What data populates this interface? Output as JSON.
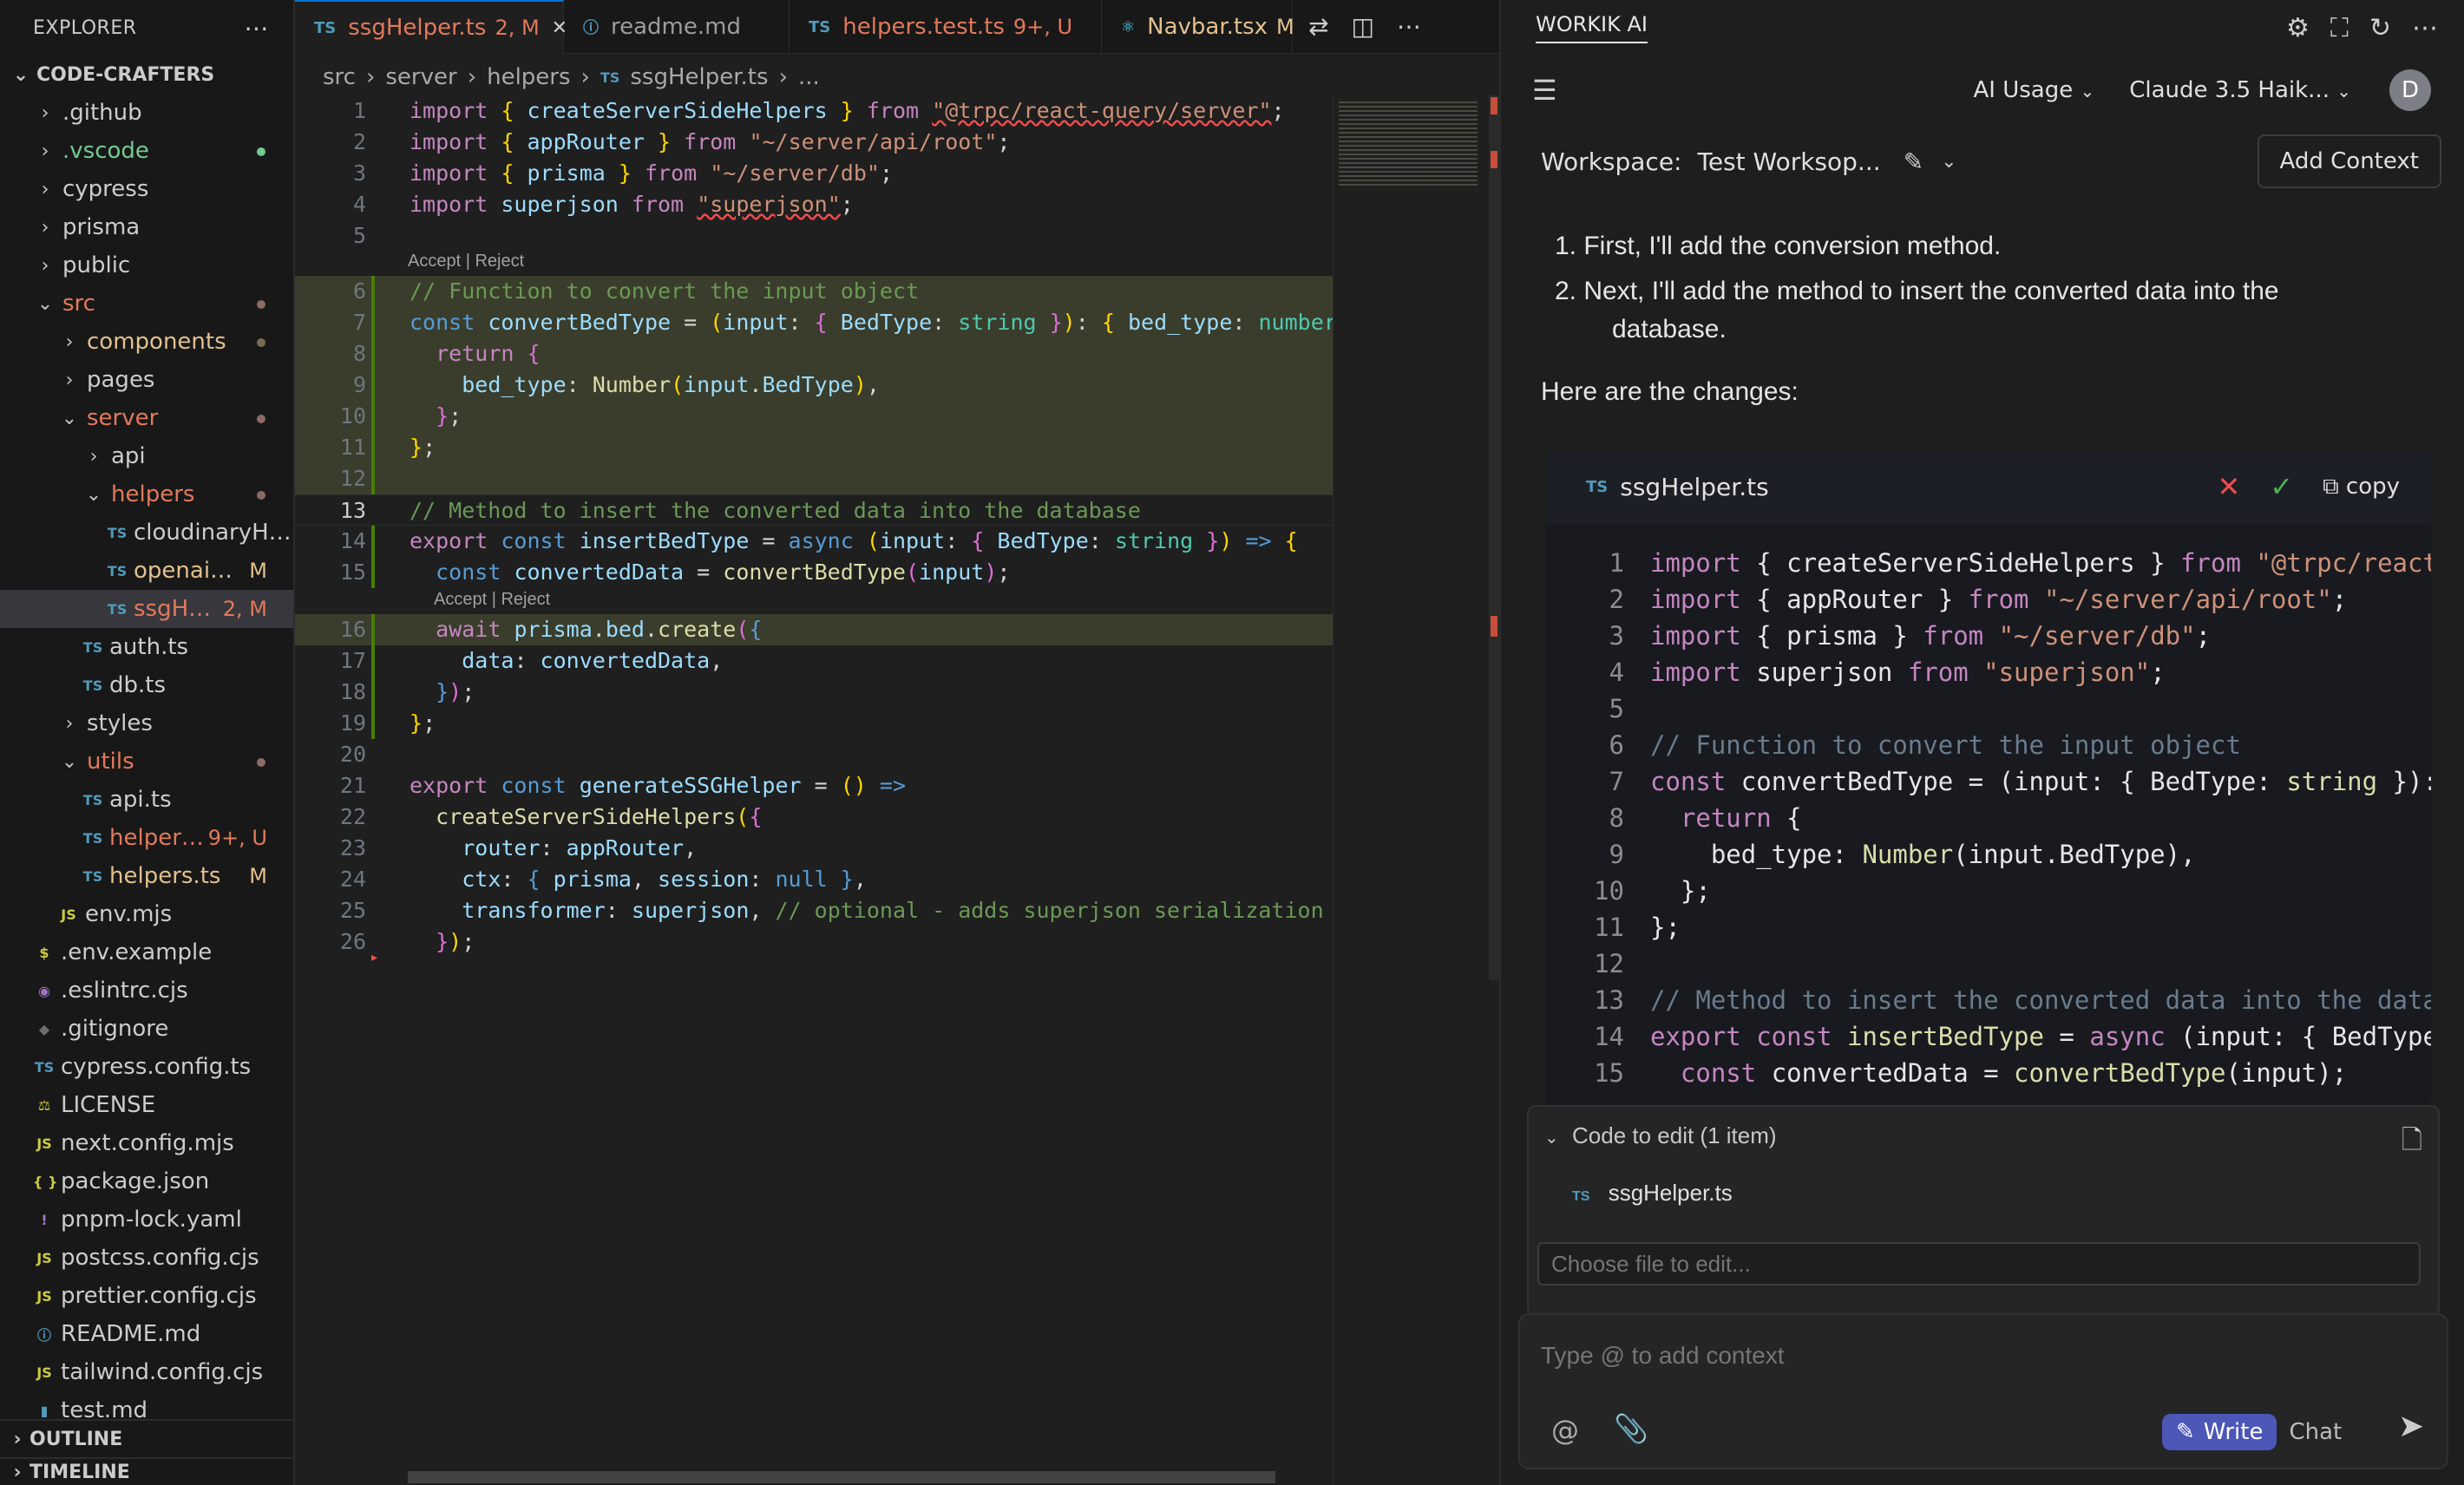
{
  "explorer": {
    "title": "EXPLORER",
    "more_icon": "ellipsis-icon",
    "root": "CODE-CRAFTERS",
    "items": [
      {
        "label": ".github",
        "type": "folder",
        "open": false,
        "depth": 1
      },
      {
        "label": ".vscode",
        "type": "folder",
        "open": false,
        "depth": 1,
        "color": "#73c991",
        "dot": "green"
      },
      {
        "label": "cypress",
        "type": "folder",
        "open": false,
        "depth": 1
      },
      {
        "label": "prisma",
        "type": "folder",
        "open": false,
        "depth": 1
      },
      {
        "label": "public",
        "type": "folder",
        "open": false,
        "depth": 1
      },
      {
        "label": "src",
        "type": "folder",
        "open": true,
        "depth": 1,
        "color": "#e2795b",
        "dot": "red"
      },
      {
        "label": "components",
        "type": "folder",
        "open": false,
        "depth": 2,
        "color": "#e2c08d",
        "dot": "brown"
      },
      {
        "label": "pages",
        "type": "folder",
        "open": false,
        "depth": 2
      },
      {
        "label": "server",
        "type": "folder",
        "open": true,
        "depth": 2,
        "color": "#e2795b",
        "dot": "red"
      },
      {
        "label": "api",
        "type": "folder",
        "open": false,
        "depth": 3
      },
      {
        "label": "helpers",
        "type": "folder",
        "open": true,
        "depth": 3,
        "color": "#e2795b",
        "dot": "red"
      },
      {
        "label": "cloudinaryHelpe...",
        "type": "ts",
        "depth": 4
      },
      {
        "label": "openaiHelp...",
        "type": "ts",
        "depth": 4,
        "color": "#e2c08d",
        "badge": "M"
      },
      {
        "label": "ssgHelp...",
        "type": "ts",
        "depth": 4,
        "color": "#e2795b",
        "badge": "2, M",
        "selected": true
      },
      {
        "label": "auth.ts",
        "type": "ts",
        "depth": 3
      },
      {
        "label": "db.ts",
        "type": "ts",
        "depth": 3
      },
      {
        "label": "styles",
        "type": "folder",
        "open": false,
        "depth": 2
      },
      {
        "label": "utils",
        "type": "folder",
        "open": true,
        "depth": 2,
        "color": "#e2795b",
        "dot": "red"
      },
      {
        "label": "api.ts",
        "type": "ts",
        "depth": 3
      },
      {
        "label": "helpers.t...",
        "type": "ts",
        "depth": 3,
        "color": "#e2795b",
        "badge": "9+, U"
      },
      {
        "label": "helpers.ts",
        "type": "ts",
        "depth": 3,
        "color": "#e2c08d",
        "badge": "M"
      },
      {
        "label": "env.mjs",
        "type": "js",
        "depth": 2
      },
      {
        "label": ".env.example",
        "type": "dollar",
        "depth": 1
      },
      {
        "label": ".eslintrc.cjs",
        "type": "eslint",
        "depth": 1
      },
      {
        "label": ".gitignore",
        "type": "git",
        "depth": 1
      },
      {
        "label": "cypress.config.ts",
        "type": "ts",
        "depth": 1
      },
      {
        "label": "LICENSE",
        "type": "license",
        "depth": 1
      },
      {
        "label": "next.config.mjs",
        "type": "js",
        "depth": 1
      },
      {
        "label": "package.json",
        "type": "json",
        "depth": 1
      },
      {
        "label": "pnpm-lock.yaml",
        "type": "yaml",
        "depth": 1
      },
      {
        "label": "postcss.config.cjs",
        "type": "js",
        "depth": 1
      },
      {
        "label": "prettier.config.cjs",
        "type": "js",
        "depth": 1
      },
      {
        "label": "README.md",
        "type": "info",
        "depth": 1
      },
      {
        "label": "tailwind.config.cjs",
        "type": "js",
        "depth": 1
      },
      {
        "label": "test.md",
        "type": "md",
        "depth": 1
      }
    ],
    "outline": "OUTLINE",
    "timeline": "TIMELINE"
  },
  "editor": {
    "tabs": [
      {
        "icon": "TS",
        "label": "ssgHelper.ts",
        "badge": "2, M",
        "active": true,
        "color": "#e2795b"
      },
      {
        "icon": "ⓘ",
        "label": "readme.md",
        "badge": "",
        "active": false,
        "color": "#9d9d9d"
      },
      {
        "icon": "TS",
        "label": "helpers.test.ts",
        "badge": "9+, U",
        "active": false,
        "color": "#e2795b"
      },
      {
        "icon": "⚛",
        "label": "Navbar.tsx",
        "badge": "M",
        "active": false,
        "color": "#e2c08d"
      }
    ],
    "breadcrumb": [
      "src",
      "server",
      "helpers",
      "ssgHelper.ts",
      "..."
    ],
    "accept_reject": "Accept | Reject",
    "lines": [
      {
        "n": "1"
      },
      {
        "n": "2"
      },
      {
        "n": "3"
      },
      {
        "n": "4"
      },
      {
        "n": "5"
      },
      {
        "n": "6"
      },
      {
        "n": "7"
      },
      {
        "n": "8"
      },
      {
        "n": "9"
      },
      {
        "n": "10"
      },
      {
        "n": "11"
      },
      {
        "n": "12"
      },
      {
        "n": "13"
      },
      {
        "n": "14"
      },
      {
        "n": "15"
      },
      {
        "n": "16"
      },
      {
        "n": "17"
      },
      {
        "n": "18"
      },
      {
        "n": "19"
      },
      {
        "n": "20"
      },
      {
        "n": "21"
      },
      {
        "n": "22"
      },
      {
        "n": "23"
      },
      {
        "n": "24"
      },
      {
        "n": "25"
      },
      {
        "n": "26"
      }
    ]
  },
  "ai": {
    "title": "WORKIK AI",
    "usage": "AI Usage",
    "model": "Claude 3.5 Haik...",
    "avatar": "D",
    "workspace_label": "Workspace:",
    "workspace_name": "Test Worksop...",
    "add_context": "Add Context",
    "step1": "1. First, I'll add the conversion method.",
    "step2": "2. Next, I'll add the method to insert the converted data into the",
    "step2b": "database.",
    "changes": "Here are the changes:",
    "card_file": "ssgHelper.ts",
    "copy": "copy",
    "edit_title": "Code to edit (1 item)",
    "edit_file": "ssgHelper.ts",
    "choose_placeholder": "Choose file to edit...",
    "input_placeholder": "Type @ to add context",
    "write": "Write",
    "chat": "Chat"
  }
}
